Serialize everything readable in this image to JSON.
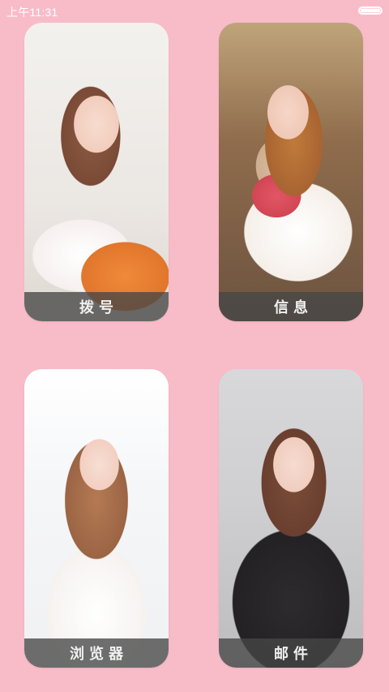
{
  "status_bar": {
    "time": "上午11:31",
    "battery_level": 1.0
  },
  "tiles": [
    {
      "label": "拨号",
      "photo": "portrait-photo-girl-with-orange-plush"
    },
    {
      "label": "信息",
      "photo": "portrait-photo-girl-with-bunny"
    },
    {
      "label": "浏览器",
      "photo": "portrait-photo-girl-in-white-dress"
    },
    {
      "label": "邮件",
      "photo": "portrait-photo-girl-in-black-veil"
    }
  ],
  "colors": {
    "background": "#f8bcc9",
    "label_bar": "rgba(70,70,70,0.78)",
    "label_text": "#f0f0f0"
  }
}
